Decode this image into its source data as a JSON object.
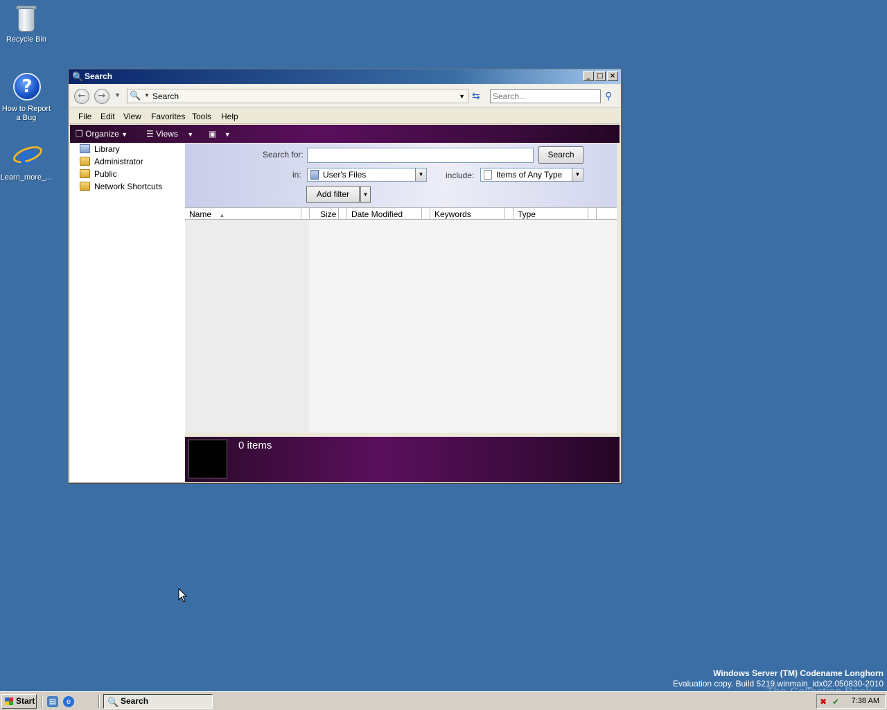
{
  "desktop": {
    "icons": [
      {
        "label": "Recycle Bin",
        "icon": "recycle-bin-icon"
      },
      {
        "label": "How to Report a Bug",
        "icon": "help-icon"
      },
      {
        "label": "Learn_more_...",
        "icon": "internet-explorer-icon"
      }
    ],
    "watermark": {
      "line1": "Windows Server (TM) Codename Longhorn",
      "line2": "Evaluation copy. Build 5219.winmain_idx02.050830-2010",
      "line3": "The Collection Book"
    }
  },
  "window": {
    "title": "Search",
    "address": "Search",
    "search_placeholder": "Search...",
    "menu": [
      "File",
      "Edit",
      "View",
      "Favorites",
      "Tools",
      "Help"
    ],
    "commands": {
      "organize": "Organize",
      "views": "Views"
    },
    "tree": [
      "Library",
      "Administrator",
      "Public",
      "Network Shortcuts"
    ],
    "search_panel": {
      "search_for_label": "Search for:",
      "search_button": "Search",
      "in_label": "in:",
      "in_value": "User's Files",
      "include_label": "include:",
      "include_value": "Items of Any Type",
      "add_filter": "Add filter"
    },
    "columns": [
      "Name",
      "Size",
      "Date Modified",
      "Keywords",
      "Type"
    ],
    "details": {
      "count": "0 items"
    }
  },
  "taskbar": {
    "start": "Start",
    "task": "Search",
    "clock": "7:38 AM"
  },
  "colors": {
    "desktop": "#3a6ea5",
    "command_bar": "#5a0f5c",
    "titlebar": "#0a246a"
  }
}
